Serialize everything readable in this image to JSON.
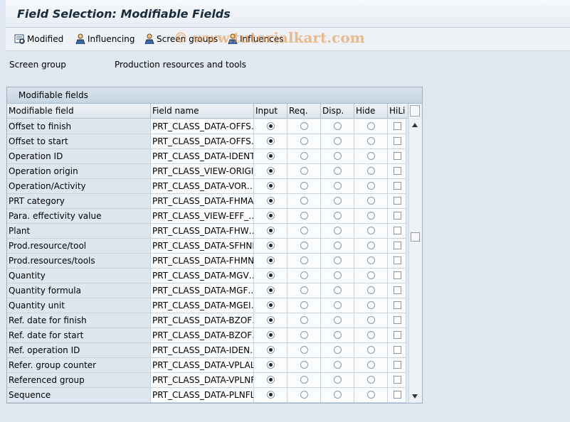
{
  "title": "Field Selection: Modifiable Fields",
  "toolbar": {
    "modified": "Modified",
    "influencing": "Influencing",
    "screen_groups": "Screen groups",
    "influences": "Influences"
  },
  "watermark": "© www.tutorialkart.com",
  "screen_group": {
    "label": "Screen group",
    "value": "Production resources and tools"
  },
  "table": {
    "caption": "Modifiable fields",
    "headers": [
      "Modifiable field",
      "Field name",
      "Input",
      "Req.",
      "Disp.",
      "Hide",
      "HiLi"
    ],
    "rows": [
      {
        "label": "Offset to finish",
        "field": "PRT_CLASS_DATA-OFFS…",
        "selected": "Input"
      },
      {
        "label": "Offset to start",
        "field": "PRT_CLASS_DATA-OFFS…",
        "selected": "Input"
      },
      {
        "label": "Operation ID",
        "field": "PRT_CLASS_DATA-IDENT",
        "selected": "Input"
      },
      {
        "label": "Operation origin",
        "field": "PRT_CLASS_VIEW-ORIGI…",
        "selected": "Input"
      },
      {
        "label": "Operation/Activity",
        "field": "PRT_CLASS_DATA-VOR…",
        "selected": "Input"
      },
      {
        "label": "PRT category",
        "field": "PRT_CLASS_DATA-FHMA…",
        "selected": "Input"
      },
      {
        "label": "Para. effectivity value",
        "field": "PRT_CLASS_VIEW-EFF_…",
        "selected": "Input"
      },
      {
        "label": "Plant",
        "field": "PRT_CLASS_DATA-FHW…",
        "selected": "Input"
      },
      {
        "label": "Prod.resource/tool",
        "field": "PRT_CLASS_DATA-SFHNR",
        "selected": "Input"
      },
      {
        "label": "Prod.resources/tools",
        "field": "PRT_CLASS_DATA-FHMN…",
        "selected": "Input"
      },
      {
        "label": "Quantity",
        "field": "PRT_CLASS_DATA-MGV…",
        "selected": "Input"
      },
      {
        "label": "Quantity formula",
        "field": "PRT_CLASS_DATA-MGF…",
        "selected": "Input"
      },
      {
        "label": "Quantity unit",
        "field": "PRT_CLASS_DATA-MGEI…",
        "selected": "Input"
      },
      {
        "label": "Ref. date for finish",
        "field": "PRT_CLASS_DATA-BZOF…",
        "selected": "Input"
      },
      {
        "label": "Ref. date for start",
        "field": "PRT_CLASS_DATA-BZOF…",
        "selected": "Input"
      },
      {
        "label": "Ref. operation ID",
        "field": "PRT_CLASS_DATA-IDEN…",
        "selected": "Input"
      },
      {
        "label": "Refer. group counter",
        "field": "PRT_CLASS_DATA-VPLAL",
        "selected": "Input"
      },
      {
        "label": "Referenced group",
        "field": "PRT_CLASS_DATA-VPLNR",
        "selected": "Input"
      },
      {
        "label": "Sequence",
        "field": "PRT_CLASS_DATA-PLNFL",
        "selected": "Input"
      }
    ]
  },
  "colors": {
    "background": "#dfe8f0",
    "label_cell": "#dde7f0",
    "value_cell": "#fbfcfd"
  }
}
